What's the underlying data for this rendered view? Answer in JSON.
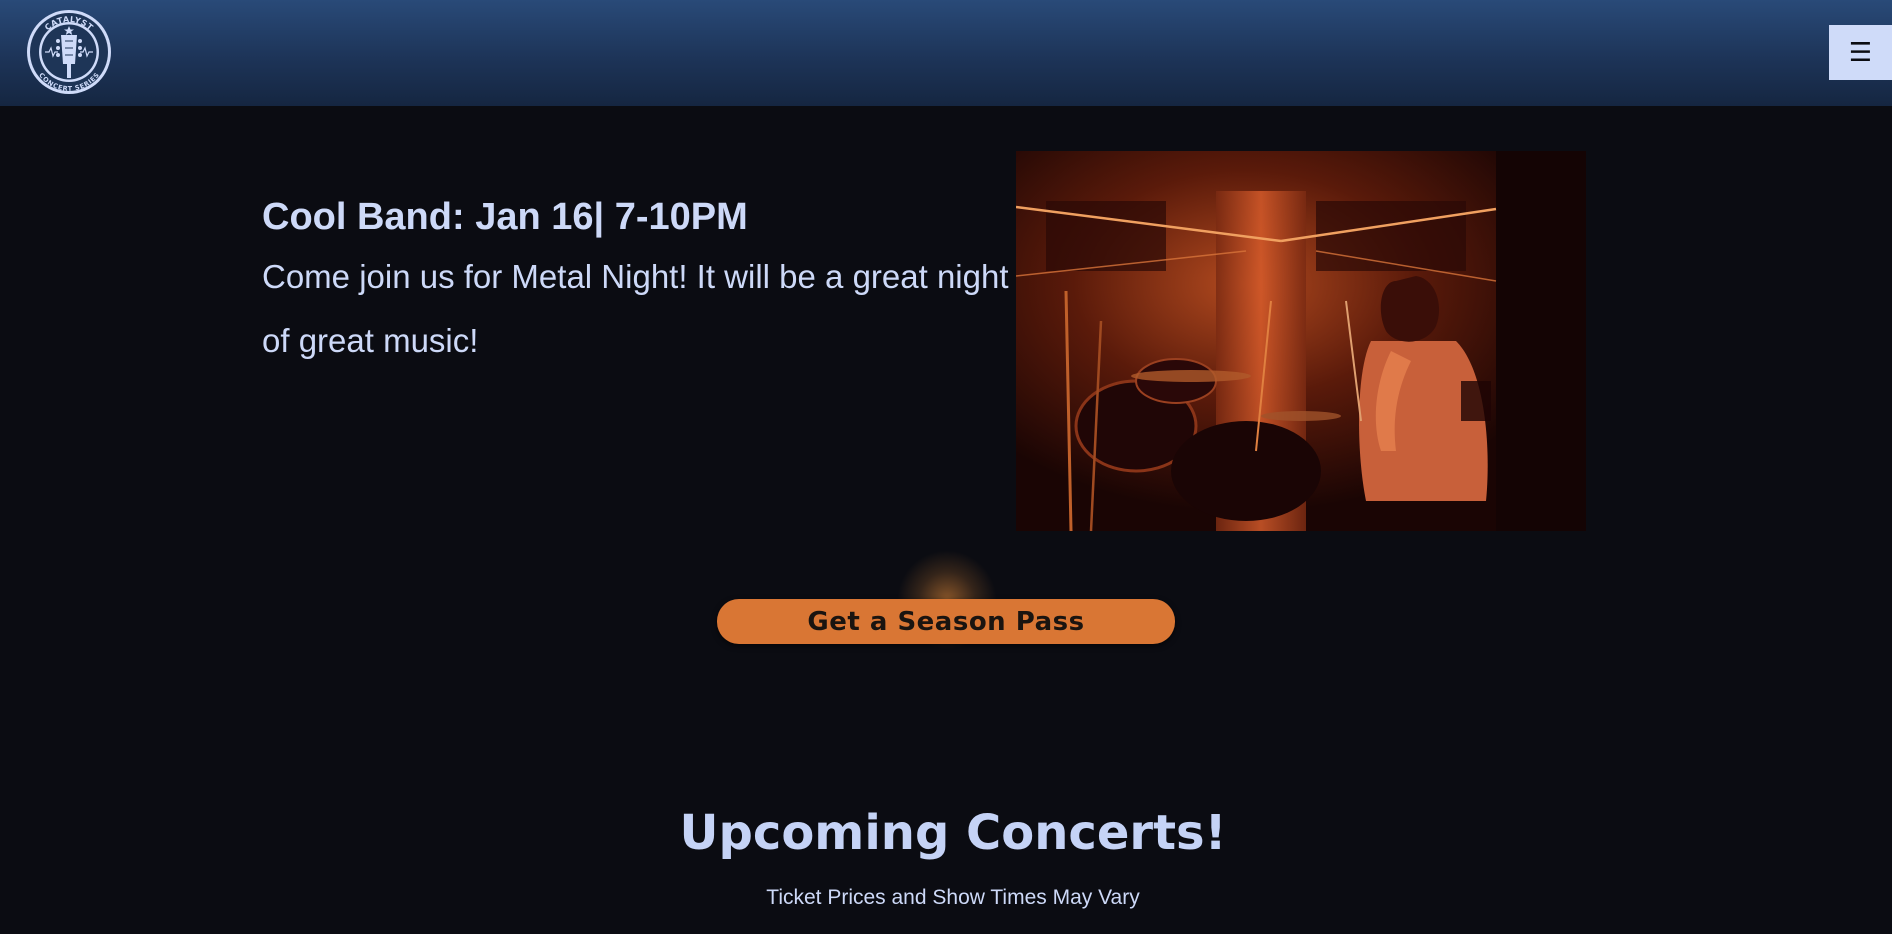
{
  "header": {
    "logo": {
      "top_text": "CATALYST",
      "bottom_text": "CONCERT SERIES",
      "icon": "guitar-headstock-icon"
    },
    "menu_button": {
      "label": "☰",
      "icon": "hamburger-menu-icon"
    }
  },
  "featured_event": {
    "title": "Cool Band: Jan 16| 7-10PM",
    "description": "Come join us for Metal Night! It will be a great night of great music!",
    "image": "drummer-on-stage-photo"
  },
  "cta": {
    "label": "Get a Season Pass",
    "color": "#d97634"
  },
  "upcoming": {
    "title": "Upcoming Concerts!",
    "subtitle": "Ticket Prices and Show Times May Vary"
  },
  "colors": {
    "background": "#0b0c12",
    "header": "#1d3458",
    "text": "#cdd9f8",
    "accent": "#d97634"
  }
}
